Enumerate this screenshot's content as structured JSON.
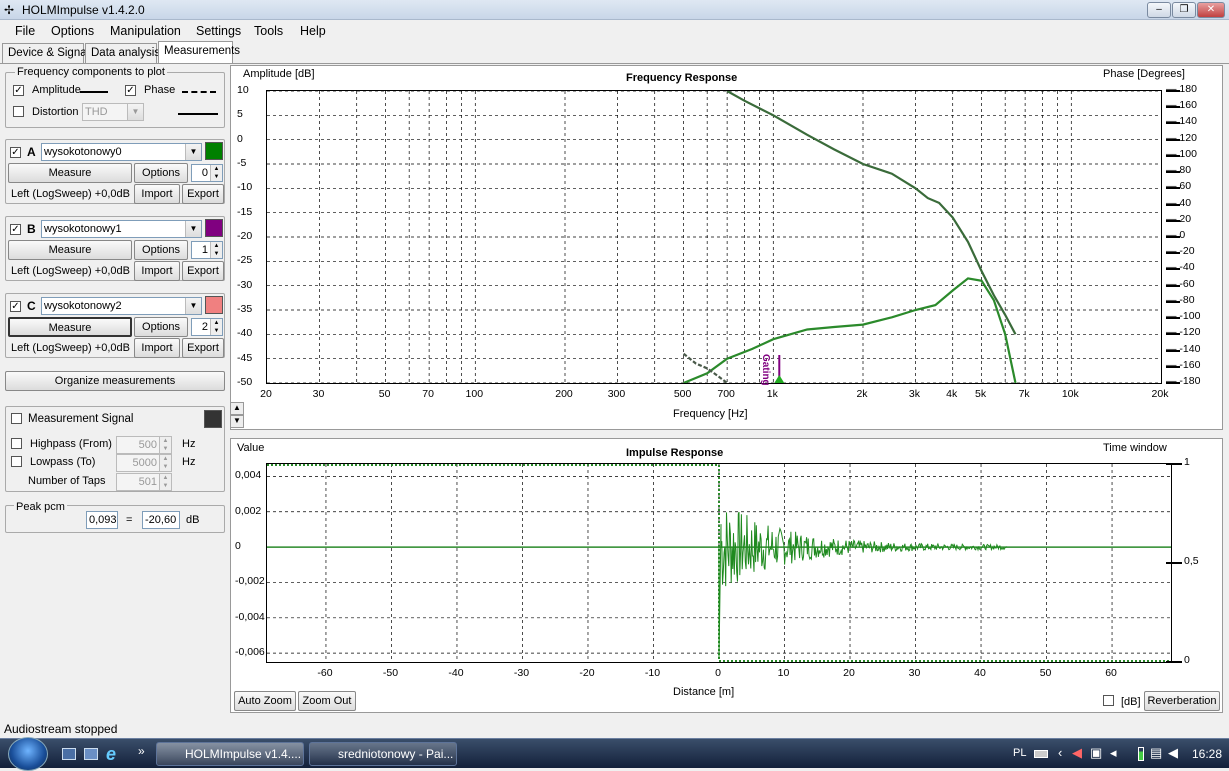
{
  "app": {
    "title": "HOLMImpulse  v1.4.2.0"
  },
  "window_buttons": {
    "minimize": "–",
    "maximize": "❐",
    "close": "✕"
  },
  "menu": [
    "File",
    "Options",
    "Manipulation",
    "Settings",
    "Tools",
    "Help"
  ],
  "tabs": [
    "Device & Signal",
    "Data analysis",
    "Measurements"
  ],
  "freq_components": {
    "title": "Frequency components to plot",
    "amplitude": "Amplitude",
    "amplitude_checked": "✓",
    "phase": "Phase",
    "phase_checked": "✓",
    "distortion": "Distortion",
    "distortion_value": "THD"
  },
  "measurements": [
    {
      "letter": "A",
      "name": "wysokotonowy0",
      "color": "#008000",
      "measure": "Measure",
      "options": "Options",
      "spin": "0",
      "info": "Left (LogSweep) +0,0dB",
      "import": "Import",
      "export": "Export",
      "checked": "✓"
    },
    {
      "letter": "B",
      "name": "wysokotonowy1",
      "color": "#800080",
      "measure": "Measure",
      "options": "Options",
      "spin": "1",
      "info": "Left (LogSweep) +0,0dB",
      "import": "Import",
      "export": "Export",
      "checked": "✓"
    },
    {
      "letter": "C",
      "name": "wysokotonowy2",
      "color": "#f08080",
      "measure": "Measure",
      "options": "Options",
      "spin": "2",
      "info": "Left (LogSweep) +0,0dB",
      "import": "Import",
      "export": "Export",
      "checked": "✓"
    }
  ],
  "organize": "Organize measurements",
  "signal": {
    "label": "Measurement Signal",
    "highpass": "Highpass (From)",
    "highpass_value": "500",
    "lowpass": "Lowpass (To)",
    "lowpass_value": "5000",
    "taps": "Number of Taps",
    "taps_value": "501",
    "hz": "Hz"
  },
  "peak": {
    "title": "Peak pcm",
    "value": "0,093",
    "eq": "=",
    "db_value": "-20,60",
    "db": "dB"
  },
  "freq_chart": {
    "title": "Frequency Response",
    "ylabel_left": "Amplitude [dB]",
    "ylabel_right": "Phase [Degrees]",
    "xlabel": "Frequency [Hz]",
    "gating": "Gating",
    "xticks": [
      "20",
      "30",
      "50",
      "70",
      "100",
      "200",
      "300",
      "500",
      "700",
      "1k",
      "2k",
      "3k",
      "4k",
      "5k",
      "7k",
      "10k",
      "20k"
    ],
    "yticks_left": [
      "10",
      "5",
      "0",
      "-5",
      "-10",
      "-15",
      "-20",
      "-25",
      "-30",
      "-35",
      "-40",
      "-45",
      "-50"
    ],
    "yticks_right": [
      "180",
      "160",
      "140",
      "120",
      "100",
      "80",
      "60",
      "40",
      "20",
      "0",
      "-20",
      "-40",
      "-60",
      "-80",
      "-100",
      "-120",
      "-140",
      "-160",
      "-180"
    ]
  },
  "impulse_chart": {
    "title": "Impulse Response",
    "ylabel_left": "Value",
    "ylabel_right": "Time window",
    "xlabel": "Distance [m]",
    "xticks": [
      "-60",
      "-50",
      "-40",
      "-30",
      "-20",
      "-10",
      "0",
      "10",
      "20",
      "30",
      "40",
      "50",
      "60"
    ],
    "yticks_left": [
      "0,004",
      "0,002",
      "0",
      "-0,002",
      "-0,004",
      "-0,006"
    ],
    "yticks_right": [
      "1",
      "0,5",
      "0"
    ]
  },
  "chart_data": [
    {
      "type": "line",
      "title": "Frequency Response",
      "xlabel": "Frequency [Hz]",
      "ylabel": "Amplitude [dB]",
      "xscale": "log",
      "xlim": [
        20,
        20000
      ],
      "ylim": [
        -50,
        10
      ],
      "y2label": "Phase [Degrees]",
      "y2lim": [
        -180,
        180
      ],
      "grid": true,
      "series": [
        {
          "values_x": [
            700,
            800,
            1000,
            1300,
            1600,
            2000,
            2500,
            3000,
            3300,
            3600,
            4000,
            4500,
            5000,
            5500,
            6000,
            6500
          ],
          "values_y": [
            10,
            8,
            5,
            1,
            -2,
            -5,
            -7,
            -10,
            -12,
            -13,
            -16,
            -21,
            -27,
            -32,
            -36,
            -40
          ]
        },
        {
          "values_x": [
            500,
            600,
            700,
            850,
            1000,
            1300,
            1600,
            2000,
            2500,
            3000,
            3500,
            4000,
            4500,
            5000,
            5500,
            6000,
            6500
          ],
          "values_y": [
            -50,
            -48,
            -45,
            -43,
            -41,
            -39,
            -38.5,
            -38,
            -36.5,
            -35,
            -34,
            -31,
            -28.5,
            -29,
            -33,
            -40,
            -50
          ]
        },
        {
          "values_x": [
            500,
            550,
            600,
            650,
            700
          ],
          "values_y": [
            -44,
            -46,
            -47,
            -48.5,
            -50
          ]
        }
      ]
    },
    {
      "type": "line",
      "title": "Impulse Response",
      "xlabel": "Distance [m]",
      "ylabel": "Value",
      "xlim": [
        -69,
        69
      ],
      "ylim": [
        -0.0065,
        0.0047
      ],
      "y2label": "Time window",
      "y2lim": [
        0,
        1
      ],
      "grid": true,
      "series": [
        {
          "values_x": [
            -69,
            0,
            0,
            0.1,
            10,
            20,
            30,
            40,
            44
          ],
          "values_y": [
            0,
            0,
            -0.0063,
            0.0013,
            0.0007,
            0.0003,
            0.00015,
            0.0001,
            0
          ]
        }
      ]
    }
  ],
  "buttons": {
    "auto_zoom": "Auto Zoom",
    "zoom_out": "Zoom Out",
    "db": "[dB]",
    "reverberation": "Reverberation"
  },
  "status": "Audiostream stopped",
  "taskbar": {
    "task1": "HOLMImpulse  v1.4....",
    "task2": "sredniotonowy - Pai...",
    "lang": "PL",
    "time": "16:28"
  }
}
